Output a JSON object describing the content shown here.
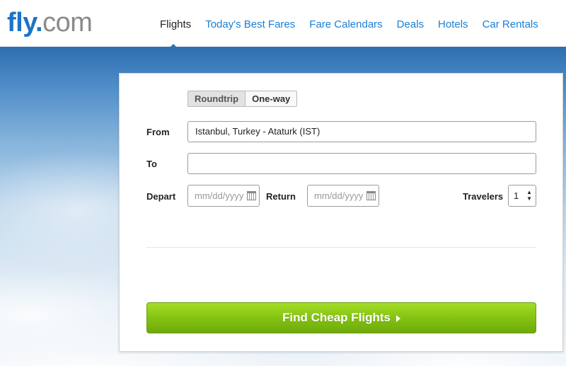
{
  "logo": {
    "fly": "fly",
    "dot": ".",
    "com": "com"
  },
  "nav": [
    {
      "label": "Flights",
      "active": true
    },
    {
      "label": "Today's Best Fares",
      "active": false
    },
    {
      "label": "Fare Calendars",
      "active": false
    },
    {
      "label": "Deals",
      "active": false
    },
    {
      "label": "Hotels",
      "active": false
    },
    {
      "label": "Car Rentals",
      "active": false
    }
  ],
  "form": {
    "trip_types": {
      "roundtrip": "Roundtrip",
      "oneway": "One-way",
      "selected": "Roundtrip"
    },
    "from_label": "From",
    "from_value": "Istanbul, Turkey - Ataturk (IST)",
    "to_label": "To",
    "to_value": "",
    "depart_label": "Depart",
    "depart_placeholder": "mm/dd/yyyy",
    "return_label": "Return",
    "return_placeholder": "mm/dd/yyyy",
    "travelers_label": "Travelers",
    "travelers_value": "1",
    "submit_label": "Find Cheap Flights"
  },
  "colors": {
    "brand": "#1a74c9",
    "cta": "#84c312",
    "nav_link": "#1a7fd4"
  },
  "icons": {
    "date_picker": "calendar-icon",
    "submit_arrow": "triangle-right-icon",
    "stepper": "up-down-arrows-icon"
  }
}
